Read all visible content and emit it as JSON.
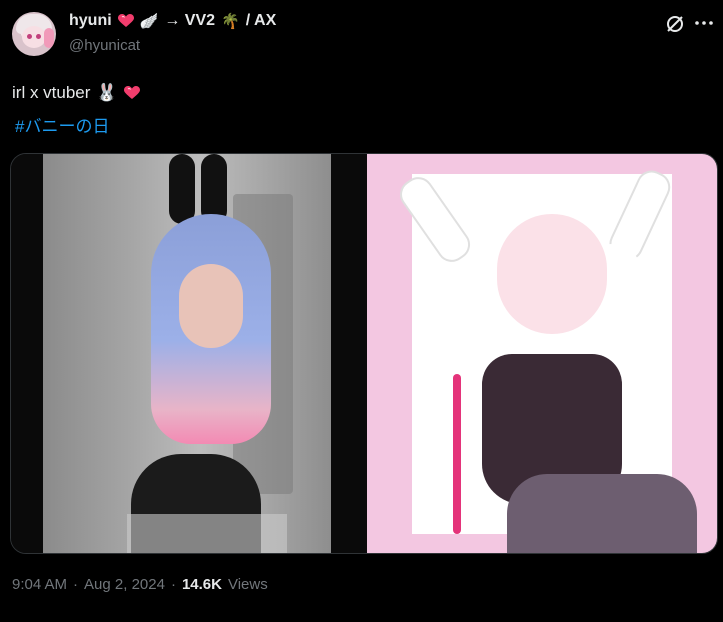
{
  "header": {
    "display_name": "hyuni",
    "display_suffix": "→ VV2",
    "display_suffix2": "/ AX",
    "handle": "@hyunicat",
    "wing_emoji": "🪽",
    "palm_emoji": "🌴"
  },
  "tweet": {
    "text": "irl x vtuber",
    "rabbit_emoji": "🐰",
    "hashtag": "#バニーの日"
  },
  "meta": {
    "time": "9:04 AM",
    "sep1": "·",
    "date": "Aug 2, 2024",
    "sep2": "·",
    "views_count": "14.6K",
    "views_label": "Views"
  },
  "icons": {
    "heart_color": "#f23d6d",
    "link_color": "#1d9bf0",
    "grok_icon": "grok-slash-icon",
    "more_icon": "more-dots-icon"
  }
}
